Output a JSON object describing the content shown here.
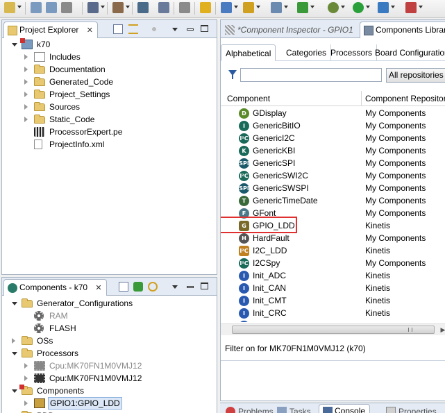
{
  "toolbar": {
    "icons": [
      "new-icon",
      "save-icon",
      "save-all-icon",
      "print-icon",
      "build-icon",
      "hammer-icon",
      "binary-icon",
      "toggle-icon",
      "anchor-icon",
      "lightning-icon",
      "new-project-icon",
      "new-component-icon",
      "new-file-icon",
      "git-icon",
      "settings-icon",
      "run-icon",
      "debug-icon",
      "external-tools-icon"
    ]
  },
  "project_explorer": {
    "tab_label": "Project Explorer",
    "tab_close": "✕",
    "tree": [
      {
        "label": "k70",
        "level": 0,
        "icon": "project",
        "expanded": true
      },
      {
        "label": "Includes",
        "level": 1,
        "icon": "includes",
        "expanded": false
      },
      {
        "label": "Documentation",
        "level": 1,
        "icon": "folder",
        "expanded": false
      },
      {
        "label": "Generated_Code",
        "level": 1,
        "icon": "folder",
        "expanded": false
      },
      {
        "label": "Project_Settings",
        "level": 1,
        "icon": "folder",
        "expanded": false
      },
      {
        "label": "Sources",
        "level": 1,
        "icon": "folder",
        "expanded": false
      },
      {
        "label": "Static_Code",
        "level": 1,
        "icon": "folder",
        "expanded": false
      },
      {
        "label": "ProcessorExpert.pe",
        "level": 1,
        "icon": "pe-file",
        "expanded": null
      },
      {
        "label": "ProjectInfo.xml",
        "level": 1,
        "icon": "xml-file",
        "expanded": null
      }
    ]
  },
  "components_view": {
    "tab_label": "Components - k70",
    "tab_close": "✕",
    "tree": [
      {
        "label": "Generator_Configurations",
        "level": 1,
        "icon": "folder",
        "expanded": true,
        "gray": false
      },
      {
        "label": "RAM",
        "level": 2,
        "icon": "gear",
        "expanded": null,
        "gray": true
      },
      {
        "label": "FLASH",
        "level": 2,
        "icon": "gear",
        "expanded": null,
        "gray": false
      },
      {
        "label": "OSs",
        "level": 1,
        "icon": "folder",
        "expanded": false,
        "gray": false
      },
      {
        "label": "Processors",
        "level": 1,
        "icon": "folder",
        "expanded": true,
        "gray": false
      },
      {
        "label": "Cpu:MK70FN1M0VMJ12",
        "level": 2,
        "icon": "chip-gray",
        "expanded": false,
        "gray": true
      },
      {
        "label": "Cpu:MK70FN1M0VMJ12",
        "level": 2,
        "icon": "chip",
        "expanded": false,
        "gray": false
      },
      {
        "label": "Components",
        "level": 1,
        "icon": "folder-error",
        "expanded": true,
        "gray": false
      },
      {
        "label": "GPIO1:GPIO_LDD",
        "level": 2,
        "icon": "gpio",
        "expanded": false,
        "gray": false,
        "selected": true
      },
      {
        "label": "PDD",
        "level": 1,
        "icon": "folder",
        "expanded": false,
        "gray": false
      }
    ]
  },
  "editor": {
    "inactive_tab": "*Component Inspector - GPIO1",
    "active_tab": "Components Library",
    "subtabs": [
      "Alphabetical",
      "Categories",
      "Processors",
      "Board Configurations"
    ],
    "filter_icon": "filter-icon",
    "filter_value": "",
    "repo_select": "All repositories",
    "columns": [
      "Component",
      "Component Repository"
    ],
    "rows": [
      {
        "name": "GDisplay",
        "repo": "My Components",
        "icon": "display",
        "color": "#5a8a2a",
        "glyph": "D"
      },
      {
        "name": "GenericBitIO",
        "repo": "My Components",
        "icon": "bitio",
        "color": "#1a6a5a",
        "glyph": "I"
      },
      {
        "name": "GenericI2C",
        "repo": "My Components",
        "icon": "i2c",
        "color": "#1a6a5a",
        "glyph": "I²C"
      },
      {
        "name": "GenericKBI",
        "repo": "My Components",
        "icon": "kbi",
        "color": "#1a6a5a",
        "glyph": "K"
      },
      {
        "name": "GenericSPI",
        "repo": "My Components",
        "icon": "spi",
        "color": "#1a5a6a",
        "glyph": "SPI"
      },
      {
        "name": "GenericSWI2C",
        "repo": "My Components",
        "icon": "swi2c",
        "color": "#1a6a5a",
        "glyph": "I²C"
      },
      {
        "name": "GenericSWSPI",
        "repo": "My Components",
        "icon": "swspi",
        "color": "#1a5a6a",
        "glyph": "SPI"
      },
      {
        "name": "GenericTimeDate",
        "repo": "My Components",
        "icon": "timedate",
        "color": "#3a6a3a",
        "glyph": "T"
      },
      {
        "name": "GFont",
        "repo": "My Components",
        "icon": "font",
        "color": "#4a7a8a",
        "glyph": "F"
      },
      {
        "name": "GPIO_LDD",
        "repo": "Kinetis",
        "icon": "gpio",
        "color": "#7a6a2a",
        "glyph": "G",
        "highlighted": true
      },
      {
        "name": "HardFault",
        "repo": "My Components",
        "icon": "hardfault",
        "color": "#555555",
        "glyph": "H"
      },
      {
        "name": "I2C_LDD",
        "repo": "Kinetis",
        "icon": "i2c-ldd",
        "color": "#c08020",
        "glyph": "I²C"
      },
      {
        "name": "I2CSpy",
        "repo": "My Components",
        "icon": "i2cspy",
        "color": "#1a6a5a",
        "glyph": "I²C"
      },
      {
        "name": "Init_ADC",
        "repo": "Kinetis",
        "icon": "init",
        "color": "#2a5ab0",
        "glyph": "I"
      },
      {
        "name": "Init_CAN",
        "repo": "Kinetis",
        "icon": "init",
        "color": "#2a5ab0",
        "glyph": "I"
      },
      {
        "name": "Init_CMT",
        "repo": "Kinetis",
        "icon": "init",
        "color": "#2a5ab0",
        "glyph": "I"
      },
      {
        "name": "Init_CRC",
        "repo": "Kinetis",
        "icon": "init",
        "color": "#2a5ab0",
        "glyph": "I"
      },
      {
        "name": "Init_DAC",
        "repo": "Kinetis",
        "icon": "init",
        "color": "#2a5ab0",
        "glyph": "I"
      }
    ],
    "status": "Filter on for MK70FN1M0VMJ12 (k70)",
    "scroll_right": "▶"
  },
  "bottom_tabs": [
    "Problems",
    "Tasks",
    "Console",
    "Properties"
  ]
}
